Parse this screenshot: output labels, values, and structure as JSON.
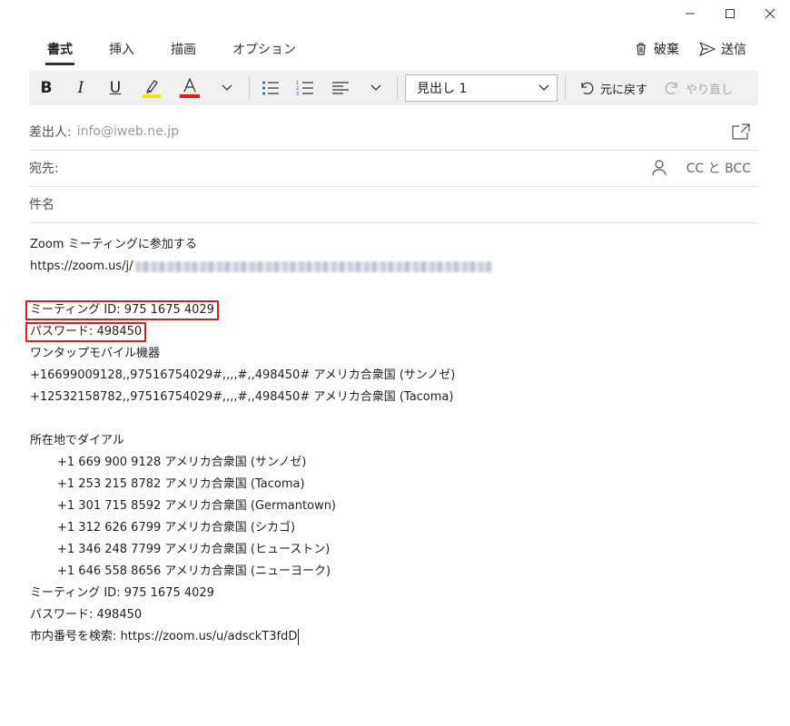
{
  "window": {
    "minimize": "—",
    "maximize": "☐",
    "close": "✕"
  },
  "tabs": [
    "書式",
    "挿入",
    "描画",
    "オプション"
  ],
  "actions": {
    "discard": "破棄",
    "send": "送信"
  },
  "toolbar": {
    "bold": "B",
    "italic": "I",
    "underline": "U",
    "style_value": "見出し 1",
    "undo_label": "元に戻す",
    "redo_label": "やり直し",
    "highlight_color": "#f5e500",
    "font_color": "#e01b1b"
  },
  "fields": {
    "from_label": "差出人:",
    "from_value": "info@iweb.ne.jp",
    "to_label": "宛先:",
    "cc_bcc": "CC と BCC",
    "subject_label": "件名"
  },
  "body": {
    "l1": "Zoom ミーティングに参加する",
    "l2": "https://zoom.us/j/",
    "meeting_id_boxed": "ミーティング ID: 975 1675 4029",
    "password_boxed": "パスワード: 498450",
    "one_tap": "ワンタップモバイル機器",
    "tap1": "+16699009128,,97516754029#,,,,#,,498450# アメリカ合衆国 (サンノゼ)",
    "tap2": "+12532158782,,97516754029#,,,,#,,498450# アメリカ合衆国 (Tacoma)",
    "dial_heading": "所在地でダイアル",
    "dial": [
      "+1 669 900 9128 アメリカ合衆国 (サンノゼ)",
      "+1 253 215 8782 アメリカ合衆国 (Tacoma)",
      "+1 301 715 8592 アメリカ合衆国 (Germantown)",
      "+1 312 626 6799 アメリカ合衆国 (シカゴ)",
      "+1 346 248 7799 アメリカ合衆国 (ヒューストン)",
      "+1 646 558 8656 アメリカ合衆国 (ニューヨーク)"
    ],
    "meeting_id": "ミーティング ID: 975 1675 4029",
    "password": "パスワード: 498450",
    "local_search": "市内番号を検索: https://zoom.us/u/adsckT3fdD"
  }
}
